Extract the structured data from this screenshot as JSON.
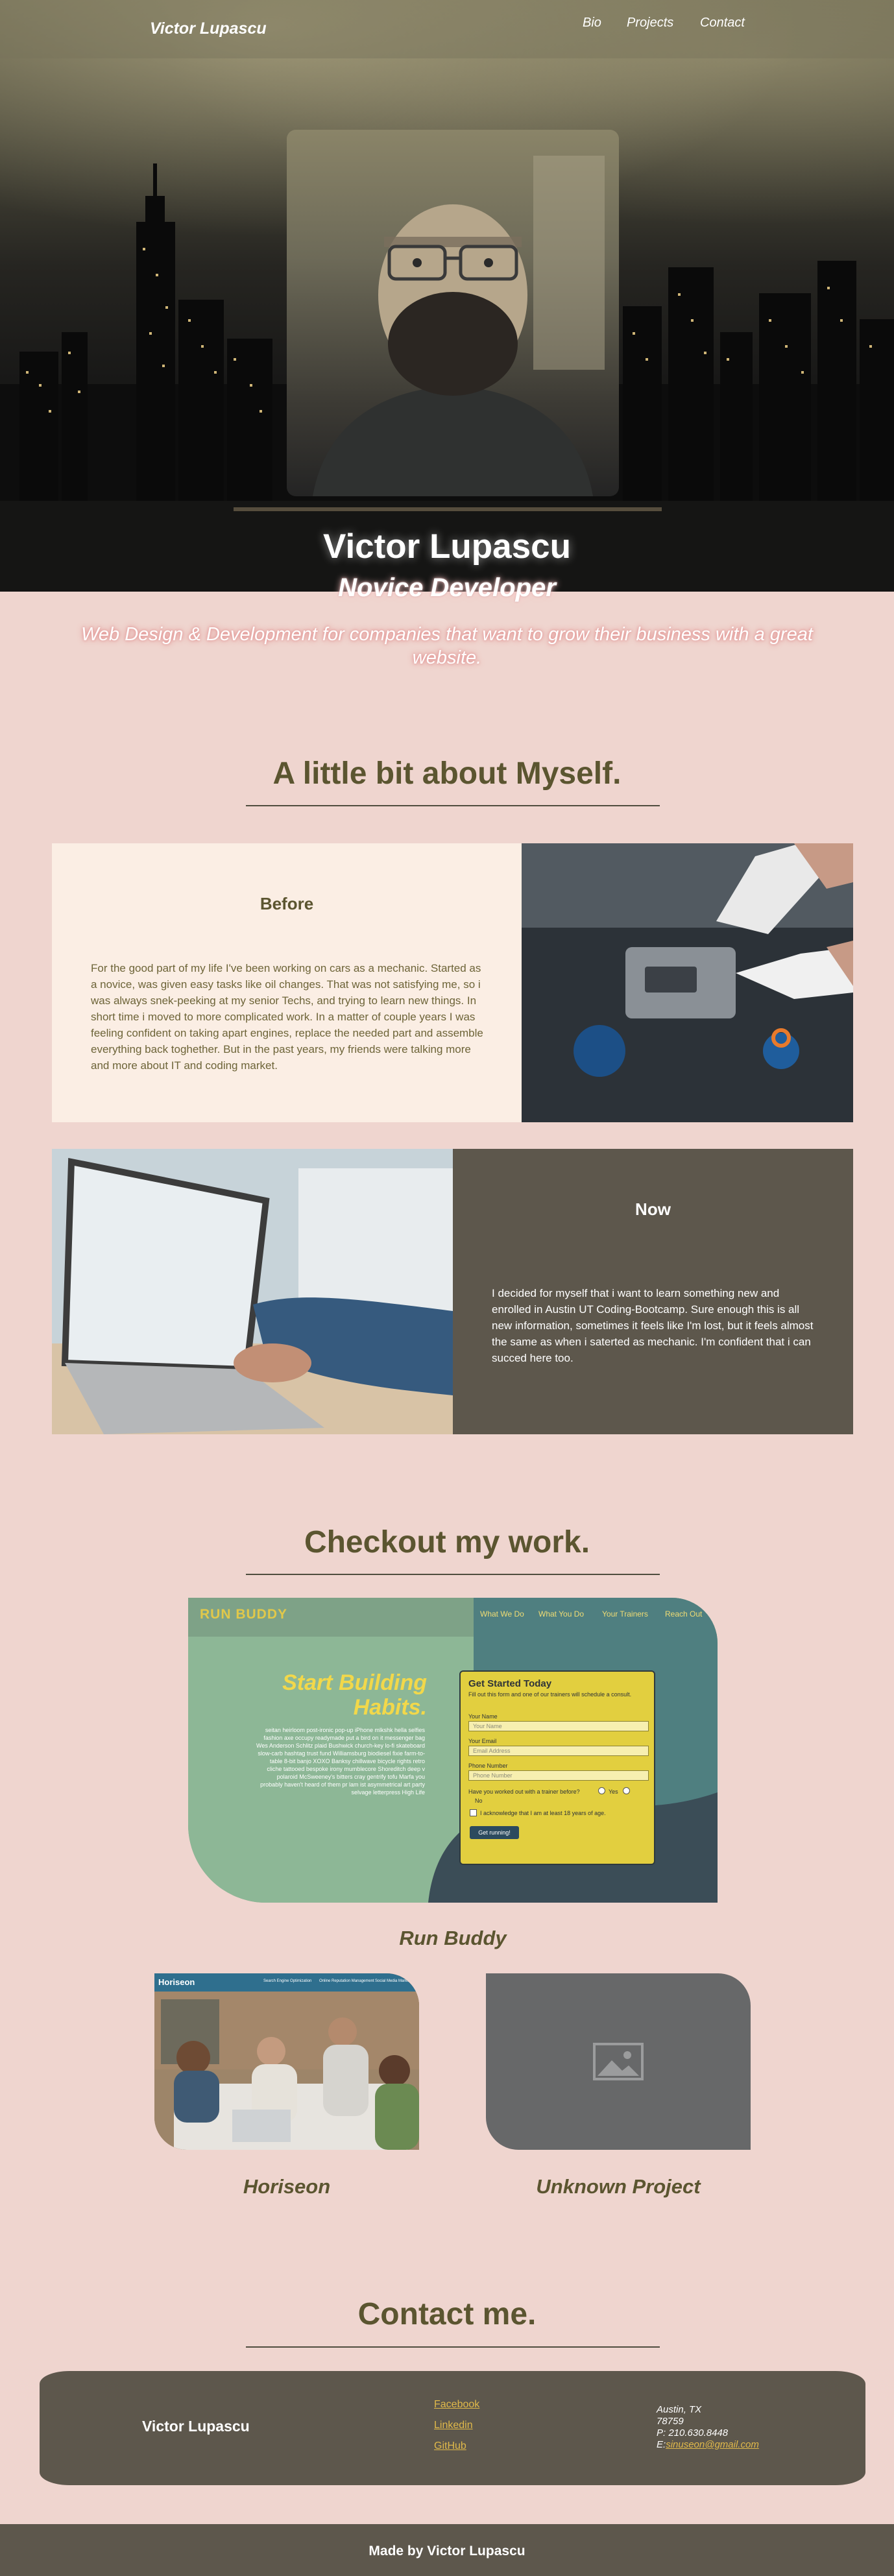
{
  "nav": {
    "brand": "Victor Lupascu",
    "links": [
      "Bio",
      "Projects",
      "Contact"
    ]
  },
  "hero": {
    "name": "Victor Lupascu",
    "role": "Novice Developer",
    "tagline": "Web Design & Development for companies that want to grow their business with a great website."
  },
  "about": {
    "heading": "A little bit about Myself.",
    "before": {
      "title": "Before",
      "text": "For the good part of my life I've been working on cars as a mechanic. Started as a novice, was given easy tasks like oil changes. That was not satisfying me, so i was always snek-peeking at my senior Techs, and trying to learn new things. In short time i moved to more complicated work. In a matter of couple years I was feeling confident on taking apart engines, replace the needed part and assemble everything back toghether. But in the past years, my friends were talking more and more about IT and coding market."
    },
    "now": {
      "title": "Now",
      "text": "I decided for myself that i want to learn something new and enrolled in Austin UT Coding-Bootcamp. Sure enough this is all new information, sometimes it feels like I'm lost, but it feels almost the same as when i saterted as mechanic. I'm confident that i can succed here too."
    }
  },
  "work": {
    "heading": "Checkout my work.",
    "projects": [
      {
        "label": "Run Buddy",
        "preview": {
          "logo": "RUN BUDDY",
          "nav": [
            "What We Do",
            "What You Do",
            "Your Trainers",
            "Reach Out"
          ],
          "headline_1": "Start Building",
          "headline_2": "Habits.",
          "body": "seitan heirloom post-ironic pop-up iPhone mlkshk hella selfies fashion axe occupy readymade put a bird on it messenger bag Wes Anderson Schlitz plaid Bushwick church-key lo-fi skateboard slow-carb hashtag trust fund Williamsburg biodiesel fixie farm-to-table 8-bit banjo XOXO Banksy chillwave bicycle rights retro cliche tattooed bespoke irony mumblecore Shoreditch deep v polaroid McSweeney's bitters cray gentrify tofu Marfa you probably haven't heard of them pr lam ist asymmetrical art party selvage letterpress High Life",
          "form_title": "Get Started Today",
          "form_sub": "Fill out this form and one of our trainers will schedule a consult.",
          "field_name": "Your Name",
          "field_name_ph": "Your Name",
          "field_email": "Your Email",
          "field_email_ph": "Email Address",
          "field_phone": "Phone Number",
          "field_phone_ph": "Phone Number",
          "question": "Have you worked out with a trainer before?",
          "yes": "Yes",
          "no": "No",
          "ack": "I acknowledge that I am at least 18 years of age.",
          "submit": "Get running!"
        }
      },
      {
        "label": "Horiseon",
        "preview": {
          "logo": "Horiseon",
          "nav": [
            "Search Engine Optimization",
            "Online Reputation Management",
            "Social Media Marketing"
          ]
        }
      },
      {
        "label": "Unknown Project"
      }
    ]
  },
  "contact": {
    "heading": "Contact me.",
    "name": "Victor Lupascu",
    "links": [
      "Facebook",
      "Linkedin",
      "GitHub"
    ],
    "city": "Austin, TX",
    "zip": "78759",
    "phone": "P: 210.630.8448",
    "email_prefix": "E:",
    "email": "sinuseon@gmail.com"
  },
  "footer": {
    "text": "Made by Victor Lupascu"
  },
  "colors": {
    "background": "#efd5cf",
    "olive": "#5b5530",
    "panel": "#5d574c",
    "link": "#e0b94a",
    "glow": "#e08b8b"
  },
  "icons": [
    "image-placeholder-icon"
  ]
}
